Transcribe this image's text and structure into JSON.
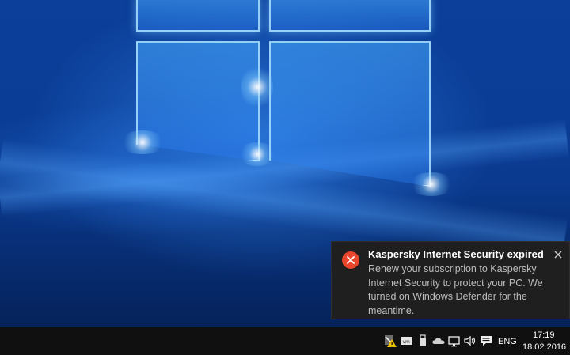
{
  "notification": {
    "title": "Kaspersky Internet Security expired",
    "message": "Renew your subscription to Kaspersky Internet Security to protect your PC. We turned on Windows Defender for the meantime.",
    "icon": "error-icon",
    "close_icon": "close-icon"
  },
  "taskbar": {
    "tray_icons": [
      "kaspersky-warning-icon",
      "vmware-icon",
      "usb-drive-icon",
      "onedrive-cloud-icon",
      "network-icon",
      "volume-icon",
      "action-center-icon"
    ],
    "language": "ENG",
    "time": "17:19",
    "date": "18.02.2016"
  },
  "colors": {
    "desktop": "#0a3d96",
    "toast_bg": "#1f1f1f",
    "error": "#e8452c",
    "taskbar": "#101010"
  }
}
